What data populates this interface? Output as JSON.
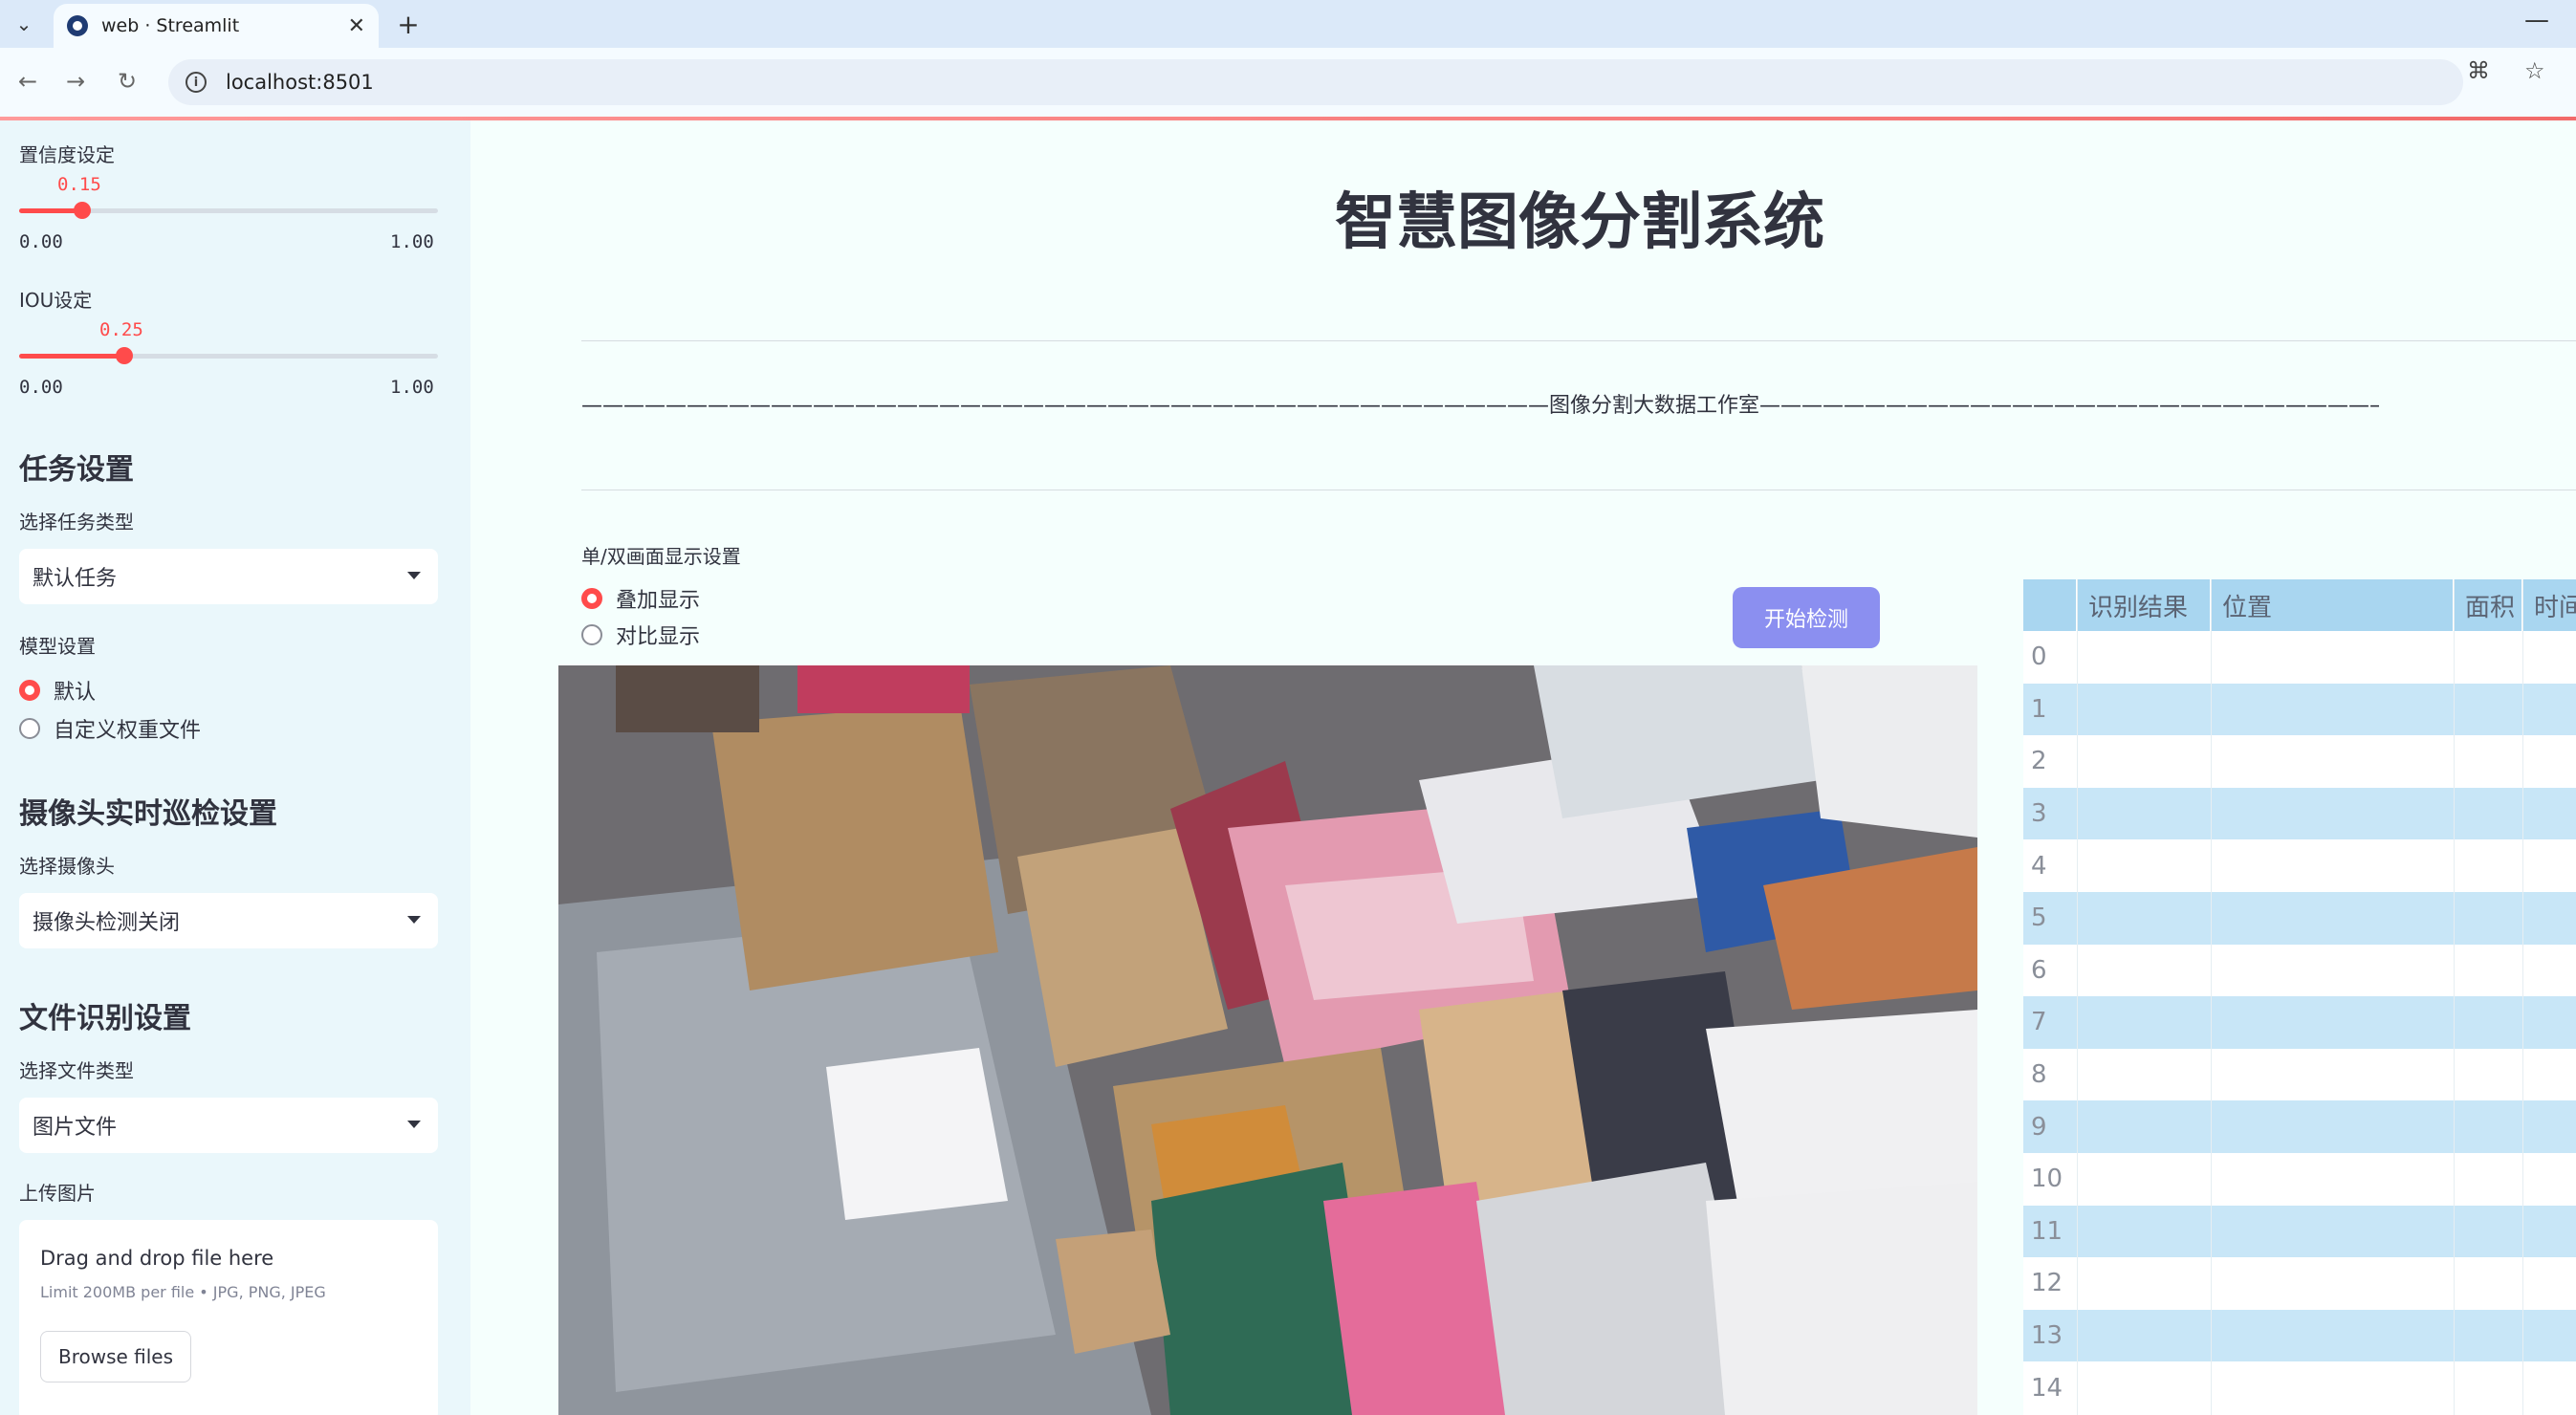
{
  "browser": {
    "tab_title": "web · Streamlit",
    "url": "localhost:8501",
    "icons": [
      "chevron-down-icon",
      "close-icon",
      "plus-icon",
      "minimize-icon",
      "back-icon",
      "forward-icon",
      "reload-icon",
      "info-icon",
      "translate-icon",
      "star-icon"
    ]
  },
  "sidebar": {
    "confidence": {
      "label": "置信度设定",
      "value": "0.15",
      "min": "0.00",
      "max": "1.00",
      "fraction": 0.15
    },
    "iou": {
      "label": "IOU设定",
      "value": "0.25",
      "min": "0.00",
      "max": "1.00",
      "fraction": 0.25
    },
    "task_header": "任务设置",
    "task_type_label": "选择任务类型",
    "task_type_value": "默认任务",
    "model_label": "模型设置",
    "model_options": [
      "默认",
      "自定义权重文件"
    ],
    "model_selected": 0,
    "camera_header": "摄像头实时巡检设置",
    "camera_label": "选择摄像头",
    "camera_value": "摄像头检测关闭",
    "file_header": "文件识别设置",
    "file_type_label": "选择文件类型",
    "file_type_value": "图片文件",
    "upload_label": "上传图片",
    "upload_title": "Drag and drop file here",
    "upload_limit": "Limit 200MB per file • JPG, PNG, JPEG",
    "browse_label": "Browse files"
  },
  "main": {
    "title": "智慧图像分割系统",
    "divider_text": "——————————————————————————————————————————————图像分割大数据工作室——————————————————————————————————————————————",
    "display_label": "单/双画面显示设置",
    "display_options": [
      "叠加显示",
      "对比显示"
    ],
    "display_selected": 0,
    "start_button": "开始检测"
  },
  "table": {
    "columns": [
      "识别结果",
      "位置",
      "面积",
      "时间"
    ],
    "row_indices": [
      "0",
      "1",
      "2",
      "3",
      "4",
      "5",
      "6",
      "7",
      "8",
      "9",
      "10",
      "11",
      "12",
      "13",
      "14"
    ]
  },
  "colors": {
    "accent": "#ff4b4b",
    "button": "#8b8ff0",
    "table_header": "#a9d6f0",
    "table_alt": "#c8e6f7"
  }
}
